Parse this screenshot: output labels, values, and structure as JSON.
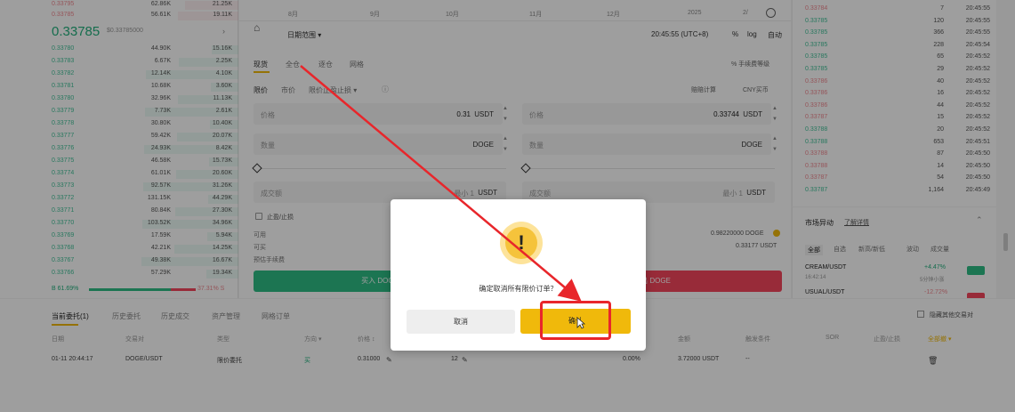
{
  "order_book": {
    "top_rows": [
      {
        "price": "0.33795",
        "amount": "62.86K",
        "total": "21.25K"
      },
      {
        "price": "0.33785",
        "amount": "56.61K",
        "total": "19.11K"
      }
    ],
    "mid_price": "0.33785",
    "mid_ref": "$0.33785000",
    "mid_arrow": "›",
    "rows": [
      {
        "price": "0.33780",
        "amount": "44.90K",
        "total": "15.16K"
      },
      {
        "price": "0.33783",
        "amount": "6.67K",
        "total": "2.25K"
      },
      {
        "price": "0.33782",
        "amount": "12.14K",
        "total": "4.10K"
      },
      {
        "price": "0.33781",
        "amount": "10.68K",
        "total": "3.60K"
      },
      {
        "price": "0.33780",
        "amount": "32.96K",
        "total": "11.13K"
      },
      {
        "price": "0.33779",
        "amount": "7.73K",
        "total": "2.61K"
      },
      {
        "price": "0.33778",
        "amount": "30.80K",
        "total": "10.40K"
      },
      {
        "price": "0.33777",
        "amount": "59.42K",
        "total": "20.07K"
      },
      {
        "price": "0.33776",
        "amount": "24.93K",
        "total": "8.42K"
      },
      {
        "price": "0.33775",
        "amount": "46.58K",
        "total": "15.73K"
      },
      {
        "price": "0.33774",
        "amount": "61.01K",
        "total": "20.60K"
      },
      {
        "price": "0.33773",
        "amount": "92.57K",
        "total": "31.26K"
      },
      {
        "price": "0.33772",
        "amount": "131.15K",
        "total": "44.29K"
      },
      {
        "price": "0.33771",
        "amount": "80.84K",
        "total": "27.30K"
      },
      {
        "price": "0.33770",
        "amount": "103.52K",
        "total": "34.96K"
      },
      {
        "price": "0.33769",
        "amount": "17.59K",
        "total": "5.94K"
      },
      {
        "price": "0.33768",
        "amount": "42.21K",
        "total": "14.25K"
      },
      {
        "price": "0.33767",
        "amount": "49.38K",
        "total": "16.67K"
      },
      {
        "price": "0.33766",
        "amount": "57.29K",
        "total": "19.34K"
      }
    ],
    "buy_ratio": "B 61.69%",
    "sell_ratio": "37.31% S"
  },
  "chart_strip": {
    "months": [
      "8月",
      "9月",
      "10月",
      "11月",
      "12月",
      "2025",
      "2/"
    ]
  },
  "trade": {
    "date_range": "日期范围 ▾",
    "clock": "20:45:55 (UTC+8)",
    "pct": "%",
    "log": "log",
    "auto": "自动",
    "tabs": [
      "现货",
      "全仓",
      "逐仓",
      "网格"
    ],
    "fee_level": "% 手续费等级",
    "order_types": [
      "限价",
      "市价",
      "限价止盈止损 ▾"
    ],
    "calculator": "赔赔计算",
    "cny": "CNY买币",
    "buy_side": {
      "price_label": "价格",
      "price_value": "0.31",
      "price_unit": "USDT",
      "qty_label": "数量",
      "qty_unit": "DOGE",
      "total_label": "成交额",
      "total_hint": "最小 1",
      "total_unit": "USDT",
      "tpsl": "止盈/止损",
      "available_label": "可用",
      "max_label": "可买",
      "fee_label": "预估手续费",
      "button": "买入 DOGE"
    },
    "sell_side": {
      "price_label": "价格",
      "price_value": "0.33744",
      "price_unit": "USDT",
      "qty_label": "数量",
      "qty_unit": "DOGE",
      "total_label": "成交额",
      "total_hint": "最小 1",
      "total_unit": "USDT",
      "available_value": "0.98220000 DOGE",
      "max_value": "0.33177 USDT",
      "button": "卖出 DOGE"
    }
  },
  "trade_history": [
    {
      "price": "0.33784",
      "amount": "7",
      "time": "20:45:55",
      "side": "sell"
    },
    {
      "price": "0.33785",
      "amount": "120",
      "time": "20:45:55",
      "side": "buy"
    },
    {
      "price": "0.33785",
      "amount": "366",
      "time": "20:45:55",
      "side": "buy"
    },
    {
      "price": "0.33785",
      "amount": "228",
      "time": "20:45:54",
      "side": "buy"
    },
    {
      "price": "0.33785",
      "amount": "65",
      "time": "20:45:52",
      "side": "buy"
    },
    {
      "price": "0.33785",
      "amount": "29",
      "time": "20:45:52",
      "side": "buy"
    },
    {
      "price": "0.33786",
      "amount": "40",
      "time": "20:45:52",
      "side": "sell"
    },
    {
      "price": "0.33786",
      "amount": "16",
      "time": "20:45:52",
      "side": "sell"
    },
    {
      "price": "0.33786",
      "amount": "44",
      "time": "20:45:52",
      "side": "sell"
    },
    {
      "price": "0.33787",
      "amount": "15",
      "time": "20:45:52",
      "side": "sell"
    },
    {
      "price": "0.33788",
      "amount": "20",
      "time": "20:45:52",
      "side": "buy"
    },
    {
      "price": "0.33788",
      "amount": "653",
      "time": "20:45:51",
      "side": "buy"
    },
    {
      "price": "0.33788",
      "amount": "87",
      "time": "20:45:50",
      "side": "sell"
    },
    {
      "price": "0.33788",
      "amount": "14",
      "time": "20:45:50",
      "side": "sell"
    },
    {
      "price": "0.33787",
      "amount": "54",
      "time": "20:45:50",
      "side": "sell"
    },
    {
      "price": "0.33787",
      "amount": "1,164",
      "time": "20:45:49",
      "side": "buy"
    }
  ],
  "market_movers": {
    "title": "市场异动",
    "link": "了解详情",
    "tabs": [
      "全部",
      "自选",
      "新高/新低",
      "波动",
      "成交量"
    ],
    "items": [
      {
        "pair": "CREAM/USDT",
        "sub": "16:42:14",
        "change": "+4.47%",
        "note": "5分钟小涨"
      },
      {
        "pair": "USUAL/USDT",
        "sub": "",
        "change": "-12.72%",
        "note": ""
      }
    ]
  },
  "orders": {
    "tabs": [
      "当前委托(1)",
      "历史委托",
      "历史成交",
      "资产管理",
      "网格订单"
    ],
    "hide_other": "隐藏其他交易对",
    "columns": [
      "日期",
      "交易对",
      "类型",
      "方向 ▾",
      "价格 ↕",
      "",
      "",
      "",
      "金额",
      "触发条件",
      "SOR",
      "止盈/止损",
      "全部撤 ▾"
    ],
    "row": {
      "date": "01-11 20:44:17",
      "pair": "DOGE/USDT",
      "type": "限价委托",
      "side": "买",
      "price": "0.31000",
      "amount": "12",
      "filled": "0.00%",
      "total": "3.72000 USDT",
      "trigger": "--",
      "sor": "--"
    }
  },
  "modal": {
    "icon": "!",
    "message": "确定取消所有限价订单？",
    "cancel": "取消",
    "confirm": "确认"
  },
  "colors": {
    "buy": "#2ebd85",
    "sell": "#f6465d",
    "accent": "#f0b90b",
    "highlight": "#e8262b"
  }
}
